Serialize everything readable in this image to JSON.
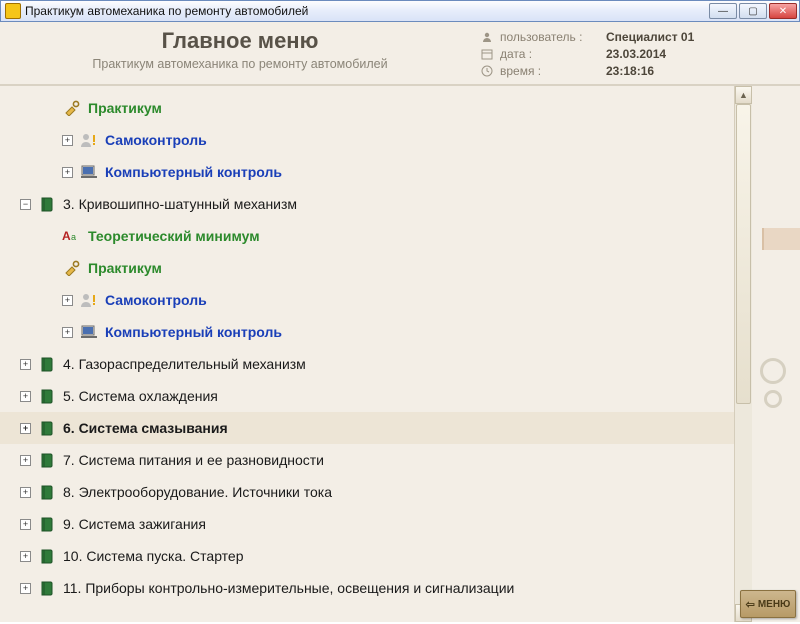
{
  "window": {
    "title": "Практикум автомеханика по ремонту автомобилей"
  },
  "header": {
    "title": "Главное меню",
    "subtitle": "Практикум автомеханика по ремонту автомобилей",
    "user_label": "пользователь :",
    "user_value": "Специалист 01",
    "date_label": "дата :",
    "date_value": "23.03.2014",
    "time_label": "время :",
    "time_value": "23:18:16"
  },
  "tree": {
    "praktikum": "Практикум",
    "self": "Самоконтроль",
    "comp": "Компьютерный контроль",
    "s3": "3. Кривошипно-шатунный механизм",
    "theory": "Теоретический минимум",
    "s4": "4. Газораспределительный механизм",
    "s5": "5. Система охлаждения",
    "s6": "6. Система смазывания",
    "s7": "7. Система питания и ее разновидности",
    "s8": "8. Электрооборудование. Источники тока",
    "s9": "9. Система зажигания",
    "s10": "10. Система пуска. Стартер",
    "s11": "11. Приборы контрольно-измерительные, освещения и сигнализации"
  },
  "buttons": {
    "menu": "МЕНЮ"
  }
}
